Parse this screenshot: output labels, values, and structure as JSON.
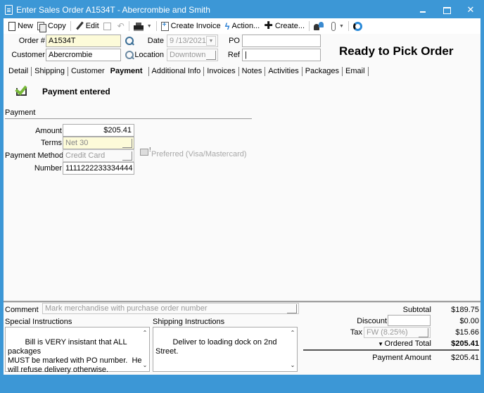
{
  "window": {
    "title": "Enter Sales Order A1534T - Abercrombie and Smith",
    "minimize_label": "minimize",
    "maximize_label": "maximize",
    "close_glyph": "✕"
  },
  "toolbar": {
    "new_label": "New",
    "copy_label": "Copy",
    "edit_label": "Edit",
    "undo_glyph": "↶",
    "caret_glyph": "▼",
    "create_invoice_label": "Create Invoice",
    "action_label": "Action...",
    "bolt_glyph": "ϟ",
    "create_label": "Create...",
    "plus_glyph": "✚"
  },
  "header": {
    "order_label": "Order #",
    "order_value": "A1534T",
    "customer_label": "Customer",
    "customer_value": "Abercrombie",
    "date_label": "Date",
    "date_value": "9 /13/2021",
    "location_label": "Location",
    "location_value": "Downtown",
    "po_label": "PO",
    "po_value": "",
    "ref_label": "Ref",
    "ref_value": "|",
    "status": "Ready to Pick Order"
  },
  "tabs": [
    {
      "label": "Detail",
      "active": false
    },
    {
      "label": "Shipping",
      "active": false
    },
    {
      "label": "Customer",
      "active": false
    },
    {
      "label": "Payment",
      "active": true
    },
    {
      "label": "Additional Info",
      "active": false
    },
    {
      "label": "Invoices",
      "active": false
    },
    {
      "label": "Notes",
      "active": false
    },
    {
      "label": "Activities",
      "active": false
    },
    {
      "label": "Packages",
      "active": false
    },
    {
      "label": "Email",
      "active": false
    }
  ],
  "payment": {
    "status": "Payment entered",
    "group_title": "Payment",
    "amount_label": "Amount",
    "amount_value": "$205.41",
    "terms_label": "Terms",
    "terms_value": "Net 30",
    "method_label": "Payment Method",
    "method_value": "Credit Card",
    "preferred_text": "Preferred (Visa/Mastercard)",
    "number_label": "Number",
    "number_value": "1111222233334444"
  },
  "footer": {
    "comment_label": "Comment",
    "comment_placeholder": "Mark merchandise with purchase order number",
    "special_label": "Special Instructions",
    "special_text": "Bill is VERY insistant that ALL packages\nMUST be marked with PO number.  He\nwill refuse delivery otherwise.",
    "shipping_label": "Shipping Instructions",
    "shipping_text": "Deliver to loading dock on 2nd Street.",
    "scroll_up_glyph": "▲",
    "scroll_down_glyph": "▼"
  },
  "totals": {
    "subtotal_label": "Subtotal",
    "subtotal_value": "$189.75",
    "discount_label": "Discount",
    "discount_input": "",
    "discount_value": "$0.00",
    "tax_label": "Tax",
    "tax_code": "FW (8.25%)",
    "tax_value": "$15.66",
    "ordered_total_glyph": "▼",
    "ordered_total_label": "Ordered Total",
    "ordered_total_value": "$205.41",
    "payment_amount_label": "Payment Amount",
    "payment_amount_value": "$205.41"
  }
}
